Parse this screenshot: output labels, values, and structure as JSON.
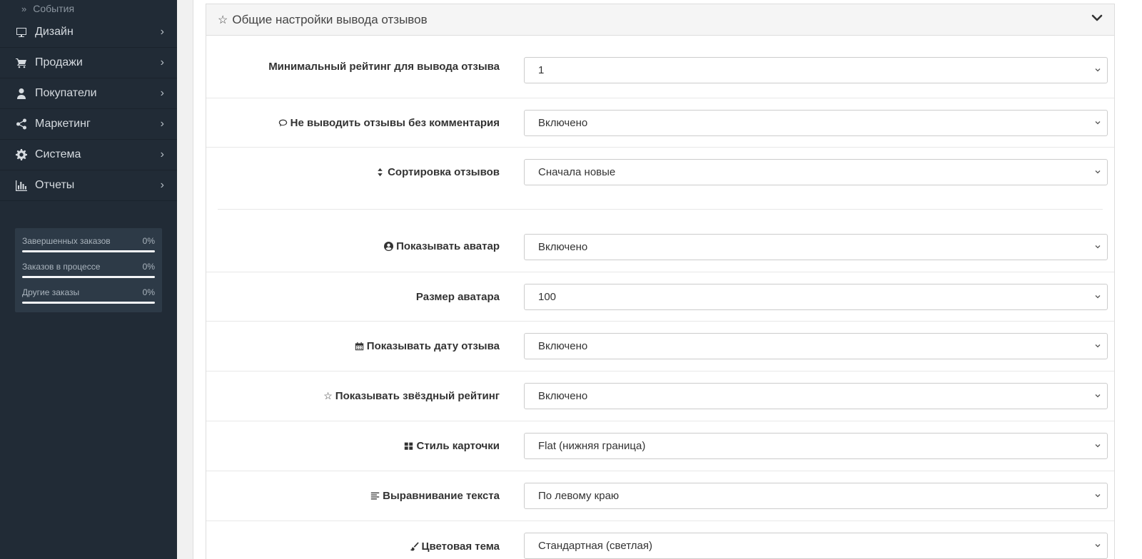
{
  "sidebar": {
    "sub_item": "События",
    "items": [
      {
        "label": "Дизайн",
        "icon": "monitor-icon"
      },
      {
        "label": "Продажи",
        "icon": "cart-icon"
      },
      {
        "label": "Покупатели",
        "icon": "user-icon"
      },
      {
        "label": "Маркетинг",
        "icon": "share-icon"
      },
      {
        "label": "Система",
        "icon": "gear-icon"
      },
      {
        "label": "Отчеты",
        "icon": "bar-chart-icon"
      }
    ],
    "stats": [
      {
        "label": "Завершенных заказов",
        "value": "0%",
        "progress": 0
      },
      {
        "label": "Заказов в процессе",
        "value": "0%",
        "progress": 0
      },
      {
        "label": "Другие заказы",
        "value": "0%",
        "progress": 0
      }
    ]
  },
  "panel": {
    "title": "Общие настройки вывода отзывов",
    "title_icon": "star-outline-icon",
    "settings": [
      {
        "label": "Минимальный рейтинг для вывода отзыва",
        "icon": "",
        "value": "1"
      },
      {
        "label": "Не выводить отзывы без комментария",
        "icon": "comment-icon",
        "value": "Включено"
      },
      {
        "label": "Сортировка отзывов",
        "icon": "sort-icon",
        "value": "Сначала новые"
      },
      {
        "label": "Показывать аватар",
        "icon": "user-circle-icon",
        "value": "Включено"
      },
      {
        "label": "Размер аватара",
        "icon": "",
        "value": "100"
      },
      {
        "label": "Показывать дату отзыва",
        "icon": "calendar-icon",
        "value": "Включено"
      },
      {
        "label": "Показывать звёздный рейтинг",
        "icon": "star-outline-icon",
        "value": "Включено"
      },
      {
        "label": "Стиль карточки",
        "icon": "grid-icon",
        "value": "Flat (нижняя граница)"
      },
      {
        "label": "Выравнивание текста",
        "icon": "align-left-icon",
        "value": "По левому краю"
      },
      {
        "label": "Цветовая тема",
        "icon": "brush-icon",
        "value": "Стандартная (светлая)"
      }
    ]
  }
}
